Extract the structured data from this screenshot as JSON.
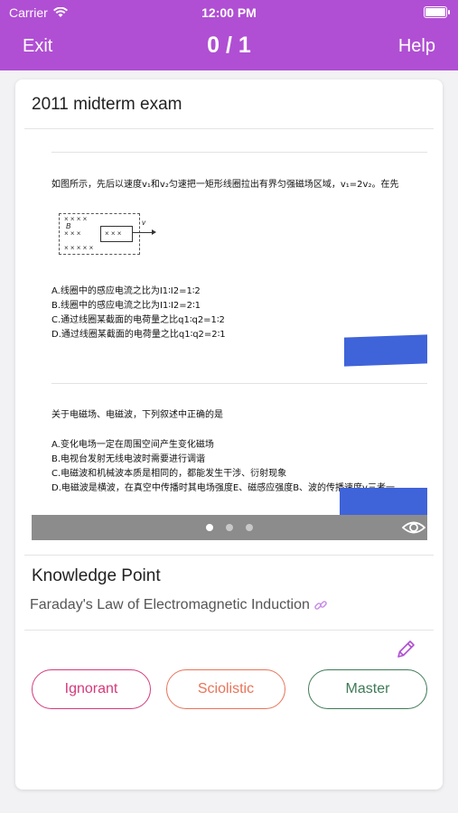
{
  "status_bar": {
    "carrier": "Carrier",
    "time": "12:00 PM"
  },
  "nav": {
    "exit_label": "Exit",
    "counter": "0 / 1",
    "help_label": "Help"
  },
  "card": {
    "title": "2011 midterm exam"
  },
  "question_image": {
    "q1": {
      "stem": "如图所示，先后以速度v₁和v₂匀速把一矩形线圈拉出有界匀强磁场区域，v₁=2v₂。在先",
      "figure_b_label": "B",
      "figure_v_label": "v",
      "options": [
        "A.线圈中的感应电流之比为I1∶I2=1∶2",
        "B.线圈中的感应电流之比为I1∶I2=2∶1",
        "C.通过线圈某截面的电荷量之比q1∶q2=1∶2",
        "D.通过线圈某截面的电荷量之比q1∶q2=2∶1"
      ]
    },
    "q2": {
      "stem": "关于电磁场、电磁波，下列叙述中正确的是",
      "options": [
        "A.变化电场一定在周围空间产生变化磁场",
        "B.电视台发射无线电波时需要进行调谐",
        "C.电磁波和机械波本质是相同的，都能发生干涉、衍射现象",
        "D.电磁波是横波，在真空中传播时其电场强度E、磁感应强度B、波的传播速度v三者一"
      ]
    },
    "pager": {
      "pages": 3,
      "current": 1
    }
  },
  "knowledge_point": {
    "title": "Knowledge Point",
    "value": "Faraday's Law of Electromagnetic Induction"
  },
  "actions": {
    "ignorant": "Ignorant",
    "sciolistic": "Sciolistic",
    "master": "Master"
  },
  "colors": {
    "header": "#b04fd3",
    "ignorant": "#d43a7c",
    "sciolistic": "#e8745a",
    "master": "#3f7a58",
    "redaction": "#3f63d9"
  },
  "icons": {
    "wifi": "wifi-icon",
    "battery": "battery-icon",
    "eye": "eye-icon",
    "link": "link-icon",
    "edit": "pencil-icon"
  }
}
